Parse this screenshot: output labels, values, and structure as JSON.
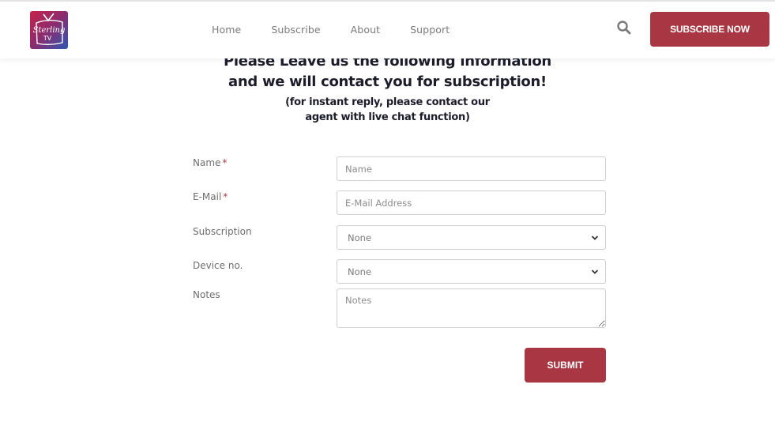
{
  "brand": {
    "logo_text_line1": "Sterling",
    "logo_text_line2": "TV",
    "accent_color": "#a83743"
  },
  "nav": {
    "items": [
      {
        "label": "Home"
      },
      {
        "label": "Subscribe"
      },
      {
        "label": "About"
      },
      {
        "label": "Support"
      }
    ],
    "search_icon": "search-icon",
    "cta_label": "SUBSCRIBE NOW"
  },
  "intro": {
    "line1": "Please Leave us the following information",
    "line2": "and we will contact you for subscription!",
    "sub_line1": "(for instant reply, please contact our",
    "sub_line2": "agent with live chat function)"
  },
  "form": {
    "name": {
      "label": "Name",
      "required_mark": "*",
      "placeholder": "Name",
      "value": ""
    },
    "email": {
      "label": "E-Mail",
      "required_mark": "*",
      "placeholder": "E-Mail Address",
      "value": ""
    },
    "subscription": {
      "label": "Subscription",
      "selected": "None"
    },
    "device": {
      "label": "Device no.",
      "selected": "None"
    },
    "notes": {
      "label": "Notes",
      "placeholder": "Notes",
      "value": ""
    },
    "submit_label": "SUBMIT"
  }
}
